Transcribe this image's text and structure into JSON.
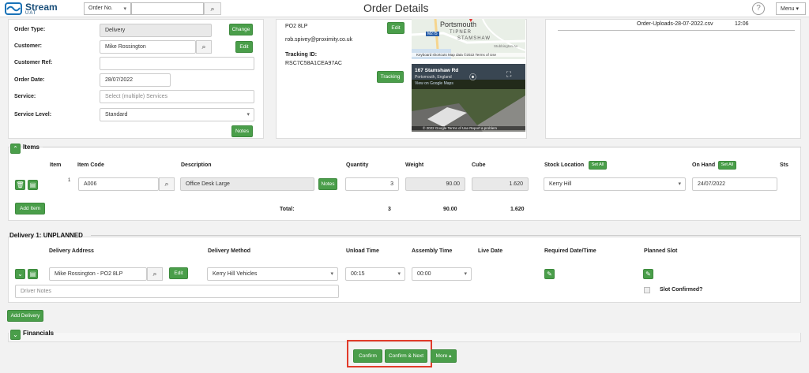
{
  "app": {
    "name": "Stream",
    "env": "UAT",
    "title": "Order Details",
    "help": "?",
    "menu_label": "Menu ▾"
  },
  "search": {
    "field": "Order No.",
    "value": ""
  },
  "order": {
    "order_type_label": "Order Type:",
    "order_type": "Delivery",
    "change_label": "Change",
    "customer_label": "Customer:",
    "customer": "Mike Rossington",
    "edit_label": "Edit",
    "customer_ref_label": "Customer Ref:",
    "customer_ref": "",
    "order_date_label": "Order Date:",
    "order_date": "28/07/2022",
    "service_label": "Service:",
    "service_placeholder": "Select (multiple) Services",
    "service_level_label": "Service Level:",
    "service_level": "Standard",
    "notes_label": "Notes"
  },
  "contact": {
    "postcode": "PO2 8LP",
    "email": "rob.spivey@proximity.co.uk",
    "edit_label": "Edit",
    "tracking_label": "Tracking ID:",
    "tracking_id": "RSC7C58A1CEA97AC",
    "tracking_button": "Tracking"
  },
  "map": {
    "city": "Portsmouth",
    "area1": "TIPNER",
    "area2": "STAMSHAW",
    "road": "M275",
    "street": "Stubbington Av",
    "footer": "Keyboard shortcuts   Map data ©2022   Terms of Use"
  },
  "streetview": {
    "title": "167 Stamshaw Rd",
    "subtitle": "Portsmouth, England",
    "link": "View on Google Maps",
    "footer": "© 2022 Google   Terms of Use   Report a problem"
  },
  "uploads": {
    "file": "Order-Uploads-28-07-2022.csv",
    "time": "12:06"
  },
  "items": {
    "section_title": "Items",
    "headers": {
      "item": "Item",
      "code": "Item Code",
      "desc": "Description",
      "qty": "Quantity",
      "weight": "Weight",
      "cube": "Cube",
      "stock": "Stock Location",
      "setall1": "Set All",
      "onhand": "On Hand",
      "setall2": "Set All",
      "sts": "Sts"
    },
    "row": {
      "num": "1",
      "code": "A006",
      "desc": "Office Desk Large",
      "notes": "Notes",
      "qty": "3",
      "weight": "90.00",
      "cube": "1.620",
      "stock": "Kerry Hill",
      "onhand": "24/07/2022"
    },
    "add_item": "Add Item",
    "totals": {
      "label": "Total:",
      "qty": "3",
      "weight": "90.00",
      "cube": "1.620"
    }
  },
  "delivery": {
    "section_title": "Delivery 1: UNPLANNED",
    "headers": {
      "address": "Delivery Address",
      "method": "Delivery Method",
      "unload": "Unload Time",
      "assembly": "Assembly Time",
      "live": "Live Date",
      "required": "Required Date/Time",
      "planned": "Planned Slot"
    },
    "address": "Mike Rossington - PO2 8LP",
    "edit_label": "Edit",
    "method": "Kerry Hill Vehicles",
    "unload": "00:15",
    "assembly": "00:00",
    "driver_notes_placeholder": "Driver Notes",
    "slot_confirmed": "Slot Confirmed?",
    "add_delivery": "Add Delivery"
  },
  "financials": {
    "section_title": "Financials"
  },
  "actions": {
    "confirm": "Confirm",
    "confirm_next": "Confirm & Next",
    "more": "More ▴"
  },
  "colors": {
    "accent": "#4a9e4a",
    "highlight": "#e23b2a",
    "brand": "#1a73b8"
  }
}
